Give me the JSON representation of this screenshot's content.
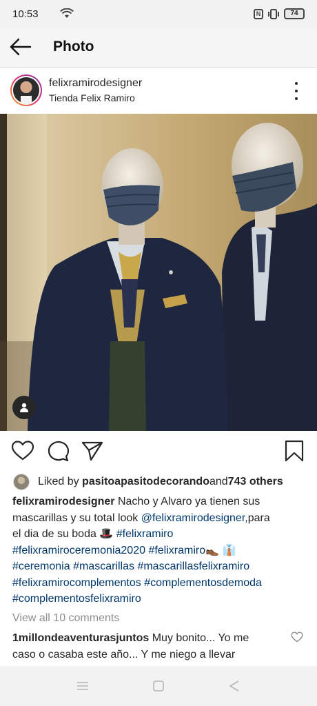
{
  "status_bar": {
    "time": "10:53",
    "nfc": "N",
    "battery": "74"
  },
  "header": {
    "title": "Photo"
  },
  "post": {
    "username": "felixramirodesigner",
    "location": "Tienda Felix Ramiro"
  },
  "likes": {
    "prefix": "Liked by ",
    "liker": "pasitoapasitodecorando",
    "and": " and ",
    "others": "743 others"
  },
  "caption": {
    "username": "felixramirodesigner",
    "line1_text": " Nacho y Alvaro ya tienen sus",
    "line2_text": "mascarillas y su total look ",
    "line2_tag": "@felixramirodesigner",
    "line2_tail": ",para",
    "line3_text": "el dia de su boda 🎩 ",
    "line3_tag": "#felixramiro",
    "line4_tag1": "#felixramiroceremonia2020",
    "line4_tag2": "#felixramiro",
    "line4_emoji": "👞 👔",
    "line5_tag1": "#ceremonia",
    "line5_tag2": "#mascarillas",
    "line5_tag3": "#mascarillasfelixramiro",
    "line6_tag1": "#felixramirocomplementos",
    "line6_tag2": "#complementosdemoda",
    "line7_tag1": "#complementosfelixramiro"
  },
  "comments": {
    "view_all": "View all 10 comments",
    "first_user": "1millondeaventurasjuntos",
    "first_line1": " Muy bonito... Yo me",
    "first_line2": "caso o casaba este año... Y me niego a llevar"
  },
  "icons": {
    "back": "arrow-left-icon",
    "more": "more-vertical-icon",
    "like": "heart-icon",
    "comment": "comment-icon",
    "share": "send-icon",
    "save": "bookmark-icon",
    "user_tag": "user-icon"
  },
  "colors": {
    "hashtag": "#00376b",
    "text": "#262626",
    "muted": "#8e8e8e"
  }
}
